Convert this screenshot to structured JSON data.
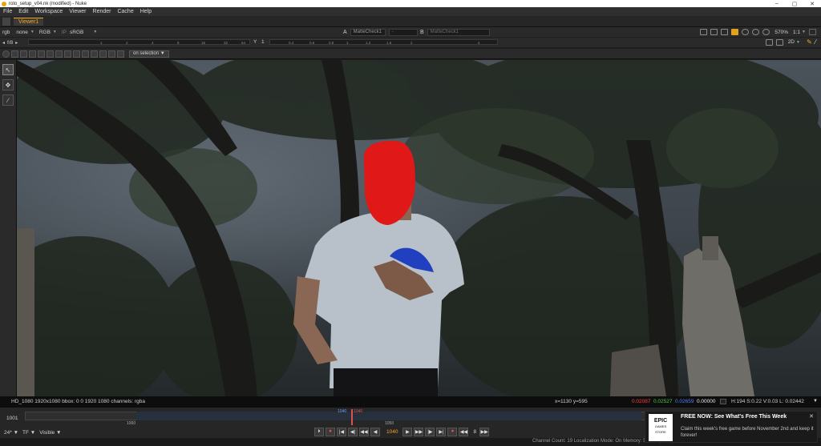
{
  "window": {
    "title": "roto_setup_v04.nk (modified) - Nuke",
    "controls": {
      "minimize": "–",
      "maximize": "▢",
      "close": "✕"
    }
  },
  "menu": [
    "File",
    "Edit",
    "Workspace",
    "Viewer",
    "Render",
    "Cache",
    "Help"
  ],
  "tabs": {
    "active": "Viewer1"
  },
  "viewer_toolbar": {
    "channels": "rgb",
    "alpha": "none",
    "display": "RGB",
    "ip_label": "IP",
    "lut": "sRGB",
    "input_a_label": "A",
    "input_a": "MatteCheck1",
    "input_a_extra": "-",
    "input_b_label": "B",
    "input_b": "MatteCheck1",
    "zoom": "570%",
    "ratio": "1:1",
    "fstop": "f/8",
    "gain_marks": [
      "1",
      "2",
      "4",
      "8",
      "16",
      "32",
      "64"
    ],
    "gamma_label": "Y",
    "gamma_value": "1",
    "gamma_marks": [
      "0.4",
      "0.6",
      "0.8",
      "1",
      "1.2",
      "1.6",
      "2",
      "4"
    ],
    "view_mode": "2D",
    "roi_mode": "on selection"
  },
  "left_tools": [
    "select-tool",
    "transform-tool",
    "brush-tool"
  ],
  "info_bar": {
    "format": "HD_1080 1920x1080  bbox: 0 0 1920 1080 channels: rgba",
    "coords": "x=1130 y=595",
    "r": "0.02087",
    "g": "0.02527",
    "b": "0.02659",
    "a": "0.00000",
    "hsv": "H:194 S:0.22 V:0.03  L: 0.02442"
  },
  "timeline": {
    "current_frame_field": "1001",
    "start_label": "1000",
    "mid_label": "1050",
    "cursor_a": "1040",
    "cursor_b": "1040",
    "cached_from": 1000,
    "cached_to": 1100,
    "range_start": 940,
    "range_end": 1100
  },
  "playback": {
    "fps": "24*",
    "tf": "TF",
    "visibility": "Visible",
    "frame": "1040",
    "increment": "8",
    "buttons": [
      "⏵",
      "|◀",
      "◀|",
      "◀◀",
      "◀",
      "▶",
      "▶▶",
      "|▶",
      "▶|",
      "⏺"
    ]
  },
  "status_bar": "Channel Count: 19  Localization Mode: On  Memory: 5.7 GB (5.6%)  CPU: 1.0%  Disk: 5.9 MB/s  Network: 0.0 MB/s",
  "notification": {
    "logo_line1": "EPIC",
    "logo_line2": "GAMES",
    "logo_line3": "STORE",
    "title": "FREE NOW: See What's Free This Week",
    "body": "Claim this week's free game before November 2nd and keep it forever!",
    "close": "✕"
  },
  "colors": {
    "accent": "#f5a623",
    "matte_overlay": "#e01818",
    "shirt_logo": "#2040c0"
  }
}
